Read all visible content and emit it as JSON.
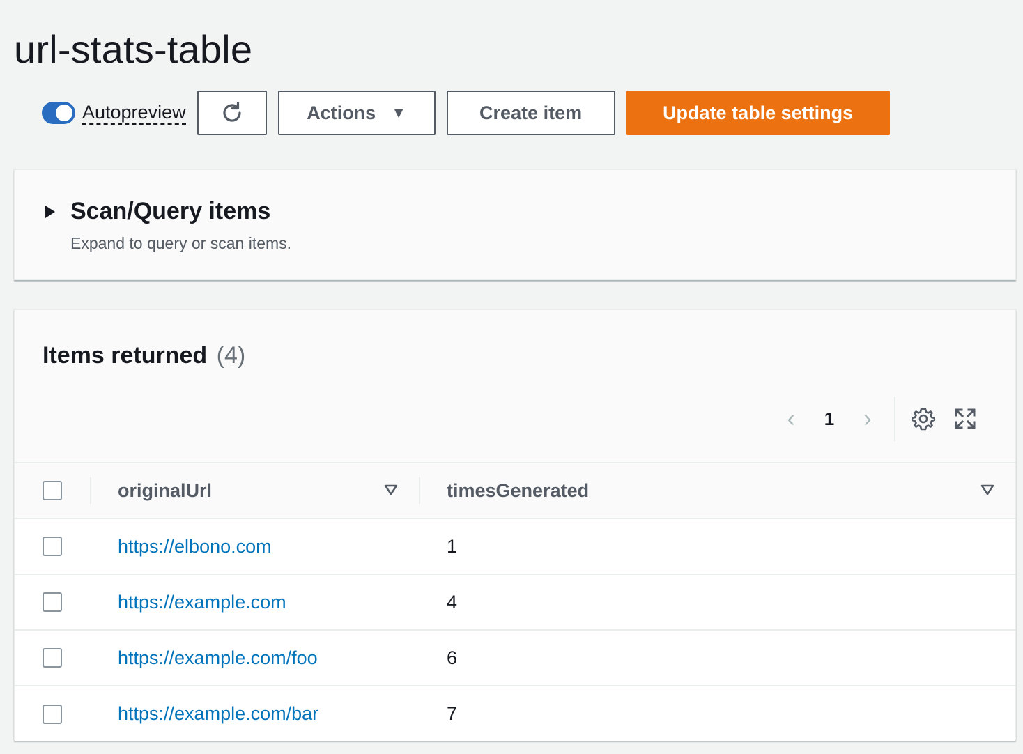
{
  "page": {
    "title": "url-stats-table"
  },
  "toolbar": {
    "autopreview_label": "Autopreview",
    "autopreview_on": true,
    "actions_label": "Actions",
    "create_label": "Create item",
    "update_label": "Update table settings"
  },
  "scan": {
    "title": "Scan/Query items",
    "description": "Expand to query or scan items."
  },
  "items": {
    "title": "Items returned",
    "count": "(4)",
    "pagination": {
      "current_page": "1"
    },
    "columns": [
      {
        "label": "originalUrl"
      },
      {
        "label": "timesGenerated"
      }
    ],
    "rows": [
      {
        "originalUrl": "https://elbono.com",
        "timesGenerated": "1"
      },
      {
        "originalUrl": "https://example.com",
        "timesGenerated": "4"
      },
      {
        "originalUrl": "https://example.com/foo",
        "timesGenerated": "6"
      },
      {
        "originalUrl": "https://example.com/bar",
        "timesGenerated": "7"
      }
    ]
  },
  "colors": {
    "primary_button": "#ec7211",
    "toggle_on": "#2a6cbf",
    "link": "#0073bb"
  },
  "icons": [
    "refresh-icon",
    "caret-down-icon",
    "expand-triangle-icon",
    "chevron-left-icon",
    "chevron-right-icon",
    "settings-gear-icon",
    "fullscreen-icon",
    "sort-icon"
  ]
}
